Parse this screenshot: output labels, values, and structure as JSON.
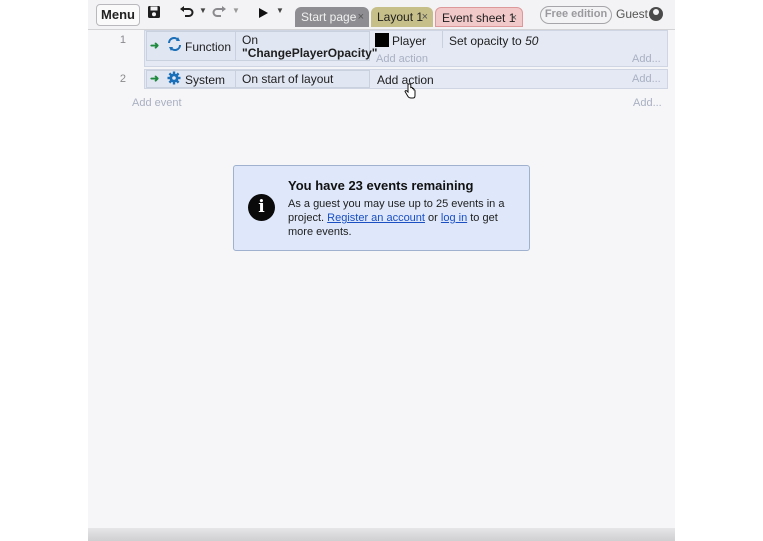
{
  "toolbar": {
    "menu_label": "Menu",
    "tabs": [
      {
        "label": "Start page",
        "close": "×"
      },
      {
        "label": "Layout 1",
        "close": "×"
      },
      {
        "label": "Event sheet 1",
        "close": "×"
      }
    ],
    "free_badge": "Free edition",
    "guest_label": "Guest",
    "icons": [
      "save-icon",
      "undo-icon",
      "redo-icon",
      "play-icon",
      "user-icon"
    ]
  },
  "events": [
    {
      "number": "1",
      "object": "Function",
      "object_icon": "function-icon",
      "condition_prefix": "On",
      "condition_value": "\"ChangePlayerOpacity\"",
      "action_object": "Player",
      "action_text": "Set opacity to",
      "action_value": "50",
      "add_action": "Add action",
      "add_right": "Add..."
    },
    {
      "number": "2",
      "object": "System",
      "object_icon": "gear-icon",
      "condition": "On start of layout",
      "add_action": "Add action",
      "add_right": "Add..."
    }
  ],
  "add_event": "Add event",
  "add_event_right": "Add...",
  "notice": {
    "title": "You have 23 events remaining",
    "body_part1": "As a guest you may use up to 25 events in a project.",
    "link_register": "Register an account",
    "body_or": "or",
    "link_login": "log in",
    "body_part2": "to get more events."
  },
  "colors": {
    "event_bg": "#e4e9f4",
    "notice_bg": "#dee8fa",
    "link": "#1a4fc4",
    "tab_active": "#f2c9c9"
  }
}
